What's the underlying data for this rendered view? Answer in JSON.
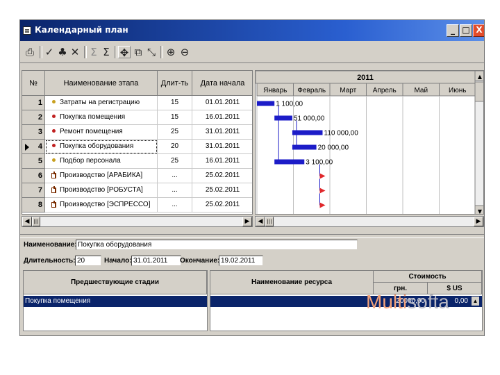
{
  "window": {
    "title": "Календарный план",
    "controls": [
      "_",
      "□",
      "X"
    ]
  },
  "toolbar": {
    "items": [
      {
        "name": "open-icon",
        "glyph": "⎙"
      },
      {
        "name": "check-icon",
        "glyph": "✓"
      },
      {
        "name": "build-icon",
        "glyph": "♣"
      },
      {
        "name": "delete-icon",
        "glyph": "✕"
      },
      {
        "name": "sum-up-icon",
        "glyph": "Σ"
      },
      {
        "name": "sum-icon",
        "glyph": "Σ"
      },
      {
        "name": "move-icon",
        "glyph": "✥"
      },
      {
        "name": "link-icon",
        "glyph": "⧉"
      },
      {
        "name": "unlink-icon",
        "glyph": "⤡"
      },
      {
        "name": "zoom-in-icon",
        "glyph": "⊕"
      },
      {
        "name": "zoom-out-icon",
        "glyph": "⊖"
      }
    ]
  },
  "stages": {
    "headers": {
      "num": "№",
      "name": "Наименование этапа",
      "duration": "Длит-ть",
      "start": "Дата начала"
    },
    "rows": [
      {
        "num": "1",
        "name": "Затраты на регистрацию",
        "duration": "15",
        "start": "01.01.2011",
        "icon": "dot",
        "color": "#c8a020"
      },
      {
        "num": "2",
        "name": "Покупка помещения",
        "duration": "15",
        "start": "16.01.2011",
        "icon": "dot",
        "color": "#c02020"
      },
      {
        "num": "3",
        "name": "Ремонт помещения",
        "duration": "25",
        "start": "31.01.2011",
        "icon": "dot",
        "color": "#c02020"
      },
      {
        "num": "4",
        "name": "Покупка оборудования",
        "duration": "20",
        "start": "31.01.2011",
        "icon": "dot",
        "color": "#c02020",
        "selected": true
      },
      {
        "num": "5",
        "name": "Подбор персонала",
        "duration": "25",
        "start": "16.01.2011",
        "icon": "dot",
        "color": "#c8a020"
      },
      {
        "num": "6",
        "name": "Производство [АРАБИКА]",
        "duration": "...",
        "start": "25.02.2011",
        "icon": "prod"
      },
      {
        "num": "7",
        "name": "Производство [РОБУСТА]",
        "duration": "...",
        "start": "25.02.2011",
        "icon": "prod"
      },
      {
        "num": "8",
        "name": "Производство [ЭСПРЕССО]",
        "duration": "...",
        "start": "25.02.2011",
        "icon": "prod"
      }
    ]
  },
  "gantt": {
    "year": "2011",
    "months": [
      "Январь",
      "Февраль",
      "Март",
      "Апрель",
      "Май",
      "Июнь"
    ],
    "bar_color": "#1c1cc8",
    "arrow_color": "#e0282c",
    "tasks": [
      {
        "start_month": 0.0,
        "end_month": 0.48,
        "label": "1 100,00"
      },
      {
        "start_month": 0.48,
        "end_month": 0.97,
        "label": "51 000,00"
      },
      {
        "start_month": 0.97,
        "end_month": 1.8,
        "label": "110 000,00"
      },
      {
        "start_month": 0.97,
        "end_month": 1.63,
        "label": "20 000,00"
      },
      {
        "start_month": 0.48,
        "end_month": 1.3,
        "label": "3 100,00"
      }
    ],
    "milestones": [
      {
        "month": 1.8
      },
      {
        "month": 1.8
      },
      {
        "month": 1.8
      }
    ]
  },
  "details": {
    "name_label": "Наименование:",
    "name_value": "Покупка оборудования",
    "duration_label": "Длительность:",
    "duration_value": "20",
    "start_label": "Начало:",
    "start_value": "31.01.2011",
    "end_label": "Окончание:",
    "end_value": "19.02.2011"
  },
  "predecessors": {
    "header": "Предшествующие стадии",
    "rows": [
      "Покупка помещения"
    ]
  },
  "resources": {
    "header": "Наименование ресурса",
    "cost_header": "Стоимость",
    "uah_header": "грн.",
    "usd_header": "$ US",
    "rows": [
      {
        "name": "",
        "uah": "20000,00",
        "usd": "0,00"
      }
    ]
  },
  "logo": {
    "part1": "Multi",
    "part2": "softa"
  },
  "scroll": {
    "left": "◀",
    "right": "▶",
    "up": "▲",
    "down": "▼",
    "grip": "|||"
  }
}
